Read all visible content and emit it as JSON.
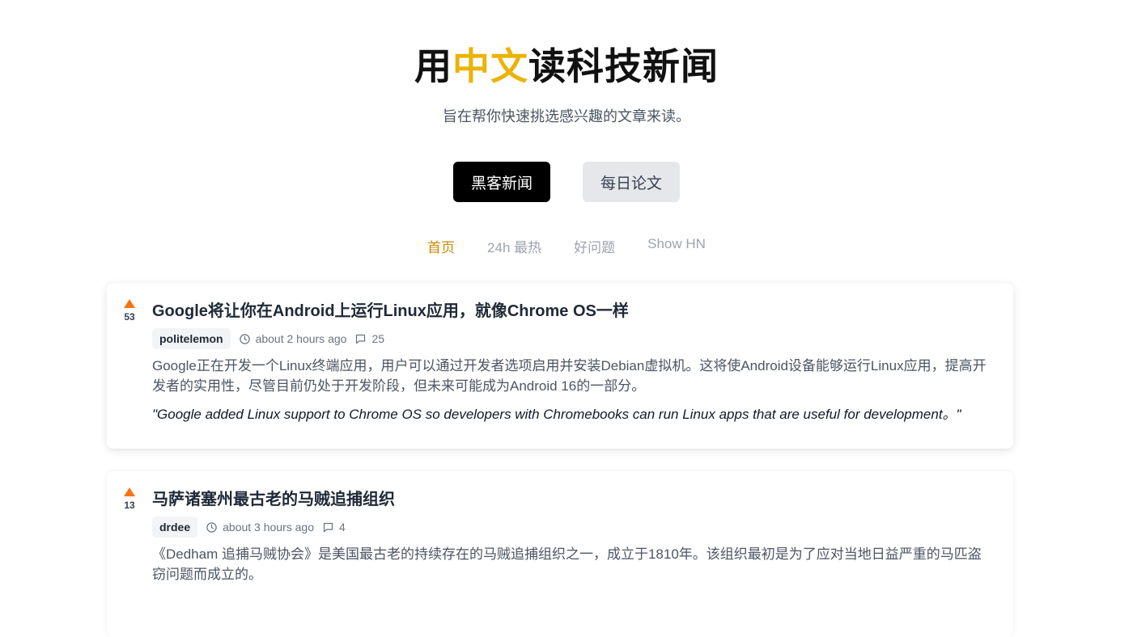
{
  "header": {
    "title_part1": "用",
    "title_highlight": "中文",
    "title_part2": "读科技新闻",
    "subtitle": "旨在帮你快速挑选感兴趣的文章来读。"
  },
  "mode_tabs": {
    "hacker_news": "黑客新闻",
    "daily_papers": "每日论文"
  },
  "sub_nav": {
    "home": "首页",
    "hot_24h": "24h 最热",
    "good_questions": "好问题",
    "show_hn": "Show HN"
  },
  "colors": {
    "accent": "#eab308",
    "active_nav": "#ca8a04",
    "upvote": "#f97316"
  },
  "stories": [
    {
      "score": "53",
      "title": "Google将让你在Android上运行Linux应用，就像Chrome OS一样",
      "author": "politelemon",
      "time": "about 2 hours ago",
      "comments": "25",
      "summary": "Google正在开发一个Linux终端应用，用户可以通过开发者选项启用并安装Debian虚拟机。这将使Android设备能够运行Linux应用，提高开发者的实用性，尽管目前仍处于开发阶段，但未来可能成为Android 16的一部分。",
      "quote": "\"Google added Linux support to Chrome OS so developers with Chromebooks can run Linux apps that are useful for development。\""
    },
    {
      "score": "13",
      "title": "马萨诸塞州最古老的马贼追捕组织",
      "author": "drdee",
      "time": "about 3 hours ago",
      "comments": "4",
      "summary": "《Dedham 追捕马贼协会》是美国最古老的持续存在的马贼追捕组织之一，成立于1810年。该组织最初是为了应对当地日益严重的马匹盗窃问题而成立的。"
    }
  ]
}
